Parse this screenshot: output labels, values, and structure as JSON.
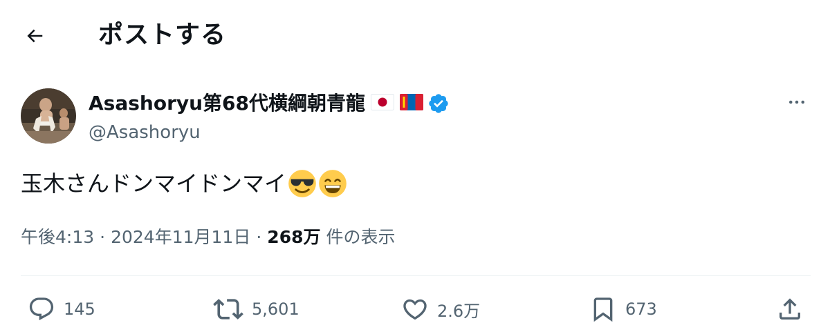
{
  "header": {
    "title": "ポストする"
  },
  "author": {
    "display_name": "Asashoryu第68代横綱朝青龍",
    "handle": "@Asashoryu"
  },
  "post": {
    "text": "玉木さんドンマイドンマイ",
    "time": "午後4:13",
    "separator": "·",
    "date": "2024年11月11日",
    "views_count": "268万",
    "views_label": "件の表示"
  },
  "actions": {
    "replies": "145",
    "reposts": "5,601",
    "likes": "2.6万",
    "bookmarks": "673"
  },
  "colors": {
    "text": "#0f1419",
    "secondary": "#536471",
    "verified": "#1d9bf0",
    "divider": "#eff3f4"
  },
  "icons": {
    "back": "arrow-left-icon",
    "more": "more-horizontal-icon",
    "reply": "reply-icon",
    "repost": "repost-icon",
    "like": "heart-icon",
    "bookmark": "bookmark-icon",
    "share": "share-icon"
  }
}
